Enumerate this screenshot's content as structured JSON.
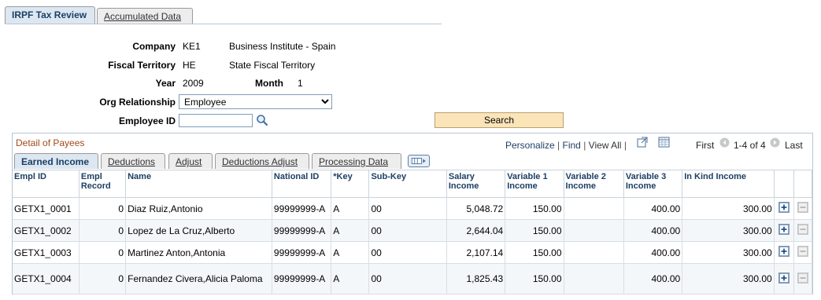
{
  "page_tabs": [
    {
      "label": "IRPF Tax Review",
      "active": true
    },
    {
      "label": "Accumulated Data",
      "active": false
    }
  ],
  "form": {
    "company_label": "Company",
    "company_code": "KE1",
    "company_name": "Business Institute - Spain",
    "fiscal_territory_label": "Fiscal Territory",
    "fiscal_territory_code": "HE",
    "fiscal_territory_name": "State Fiscal Territory",
    "year_label": "Year",
    "year_value": "2009",
    "month_label": "Month",
    "month_value": "1",
    "org_relationship_label": "Org Relationship",
    "org_relationship_value": "Employee",
    "employee_id_label": "Employee ID",
    "employee_id_value": "",
    "search_label": "Search"
  },
  "grid": {
    "title": "Detail of Payees",
    "personalize": "Personalize",
    "find": "Find",
    "view_all": "View All",
    "first": "First",
    "range": "1-4 of 4",
    "last": "Last",
    "tabs": [
      {
        "label": "Earned Income",
        "active": true
      },
      {
        "label": "Deductions",
        "active": false
      },
      {
        "label": "Adjust",
        "active": false
      },
      {
        "label": "Deductions Adjust",
        "active": false
      },
      {
        "label": "Processing Data",
        "active": false
      }
    ],
    "columns": [
      "Empl ID",
      "Empl Record",
      "Name",
      "National ID",
      "*Key",
      "Sub-Key",
      "Salary Income",
      "Variable 1 Income",
      "Variable 2 Income",
      "Variable 3 Income",
      "In Kind Income"
    ],
    "rows": [
      [
        "GETX1_0001",
        "0",
        "Diaz Ruiz,Antonio",
        "99999999-A",
        "A",
        "00",
        "5,048.72",
        "150.00",
        "",
        "400.00",
        "300.00"
      ],
      [
        "GETX1_0002",
        "0",
        "Lopez de La Cruz,Alberto",
        "99999999-A",
        "A",
        "00",
        "2,644.04",
        "150.00",
        "",
        "400.00",
        "300.00"
      ],
      [
        "GETX1_0003",
        "0",
        "Martinez Anton,Antonia",
        "99999999-A",
        "A",
        "00",
        "2,107.14",
        "150.00",
        "",
        "400.00",
        "300.00"
      ],
      [
        "GETX1_0004",
        "0",
        "Fernandez Civera,Alicia Paloma",
        "99999999-A",
        "A",
        "00",
        "1,825.43",
        "150.00",
        "",
        "400.00",
        "300.00"
      ]
    ]
  },
  "colors": {
    "accent": "#1d3f63",
    "title": "#a24a1a",
    "search_button": "#fbe4b8"
  }
}
